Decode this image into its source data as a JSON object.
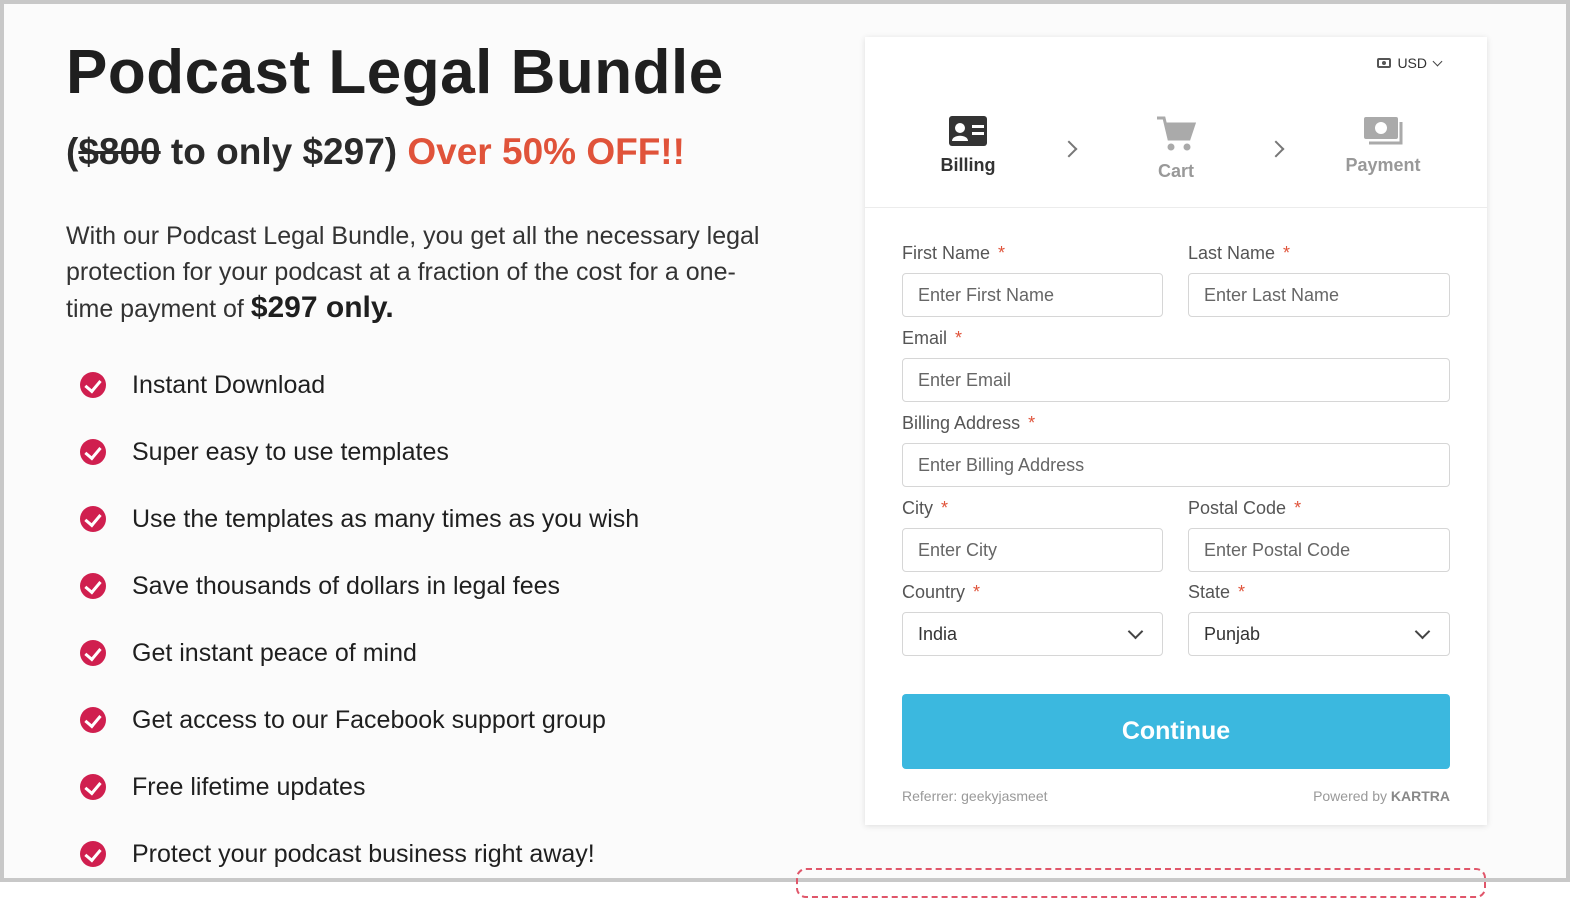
{
  "product": {
    "title": "Podcast Legal Bundle",
    "price_open": "(",
    "old_price": "$800",
    "price_mid": " to only $297) ",
    "promo": "Over 50% OFF!!",
    "intro_text": "With our Podcast Legal Bundle, you get all the necessary legal protection for your podcast at a fraction of the cost for a one-time payment of ",
    "intro_bold": "$297 only."
  },
  "features": [
    "Instant Download",
    "Super easy to use templates",
    "Use the templates as many times as you wish",
    "Save thousands of dollars in legal fees",
    "Get instant peace of mind",
    "Get access to our Facebook support group",
    "Free lifetime updates",
    "Protect your podcast business right away!"
  ],
  "checkout": {
    "currency": "USD",
    "steps": {
      "billing": "Billing",
      "cart": "Cart",
      "payment": "Payment"
    },
    "required_mark": "*",
    "fields": {
      "first_name": {
        "label": "First Name",
        "placeholder": "Enter First Name"
      },
      "last_name": {
        "label": "Last Name",
        "placeholder": "Enter Last Name"
      },
      "email": {
        "label": "Email",
        "placeholder": "Enter Email"
      },
      "billing_address": {
        "label": "Billing Address",
        "placeholder": "Enter Billing Address"
      },
      "city": {
        "label": "City",
        "placeholder": "Enter City"
      },
      "postal_code": {
        "label": "Postal Code",
        "placeholder": "Enter Postal Code"
      },
      "country": {
        "label": "Country",
        "value": "India"
      },
      "state": {
        "label": "State",
        "value": "Punjab"
      }
    },
    "continue_label": "Continue",
    "referrer": "Referrer: geekyjasmeet",
    "powered_by": "Powered by ",
    "brand": "KARTRA"
  },
  "colors": {
    "accent_red": "#e0533a",
    "check_red": "#d01f4f",
    "button_blue": "#3bb8df"
  }
}
